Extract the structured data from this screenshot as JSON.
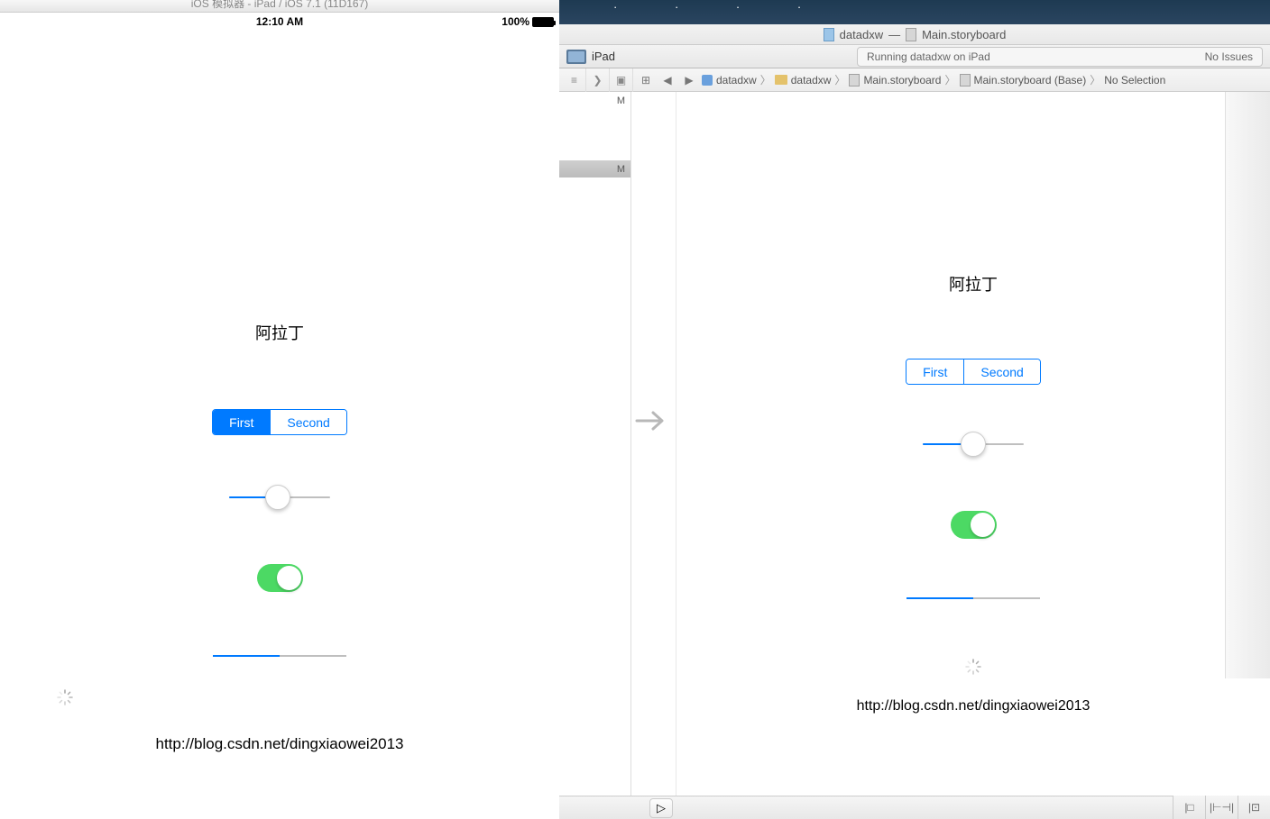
{
  "simulator": {
    "window_title": "iOS 模拟器 - iPad / iOS 7.1 (11D167)",
    "status_time": "12:10 AM",
    "battery_pct": "100%",
    "label_title": "阿拉丁",
    "segments": [
      "First",
      "Second"
    ],
    "selected_segment": 0,
    "slider_value_pct": 48,
    "switch_on": true,
    "progress_pct": 50,
    "blog_url": "http://blog.csdn.net/dingxiaowei2013"
  },
  "xcode": {
    "title_left": "datadxw",
    "title_right": "Main.storyboard",
    "target_device": "iPad",
    "activity_text": "Running datadxw on iPad",
    "issues_text": "No Issues",
    "jumpbar": {
      "project": "datadxw",
      "group": "datadxw",
      "file": "Main.storyboard",
      "subfile": "Main.storyboard (Base)",
      "selection": "No Selection"
    },
    "navigator": {
      "rows": [
        {
          "badge": "M",
          "selected": false
        },
        {
          "badge": "",
          "selected": false
        },
        {
          "badge": "",
          "selected": false
        },
        {
          "badge": "",
          "selected": false
        },
        {
          "badge": "M",
          "selected": true
        }
      ]
    },
    "storyboard": {
      "label_title": "阿拉丁",
      "segments": [
        "First",
        "Second"
      ],
      "slider_value_pct": 50,
      "switch_on": true,
      "progress_pct": 50,
      "blog_url": "http://blog.csdn.net/dingxiaowei2013"
    }
  }
}
